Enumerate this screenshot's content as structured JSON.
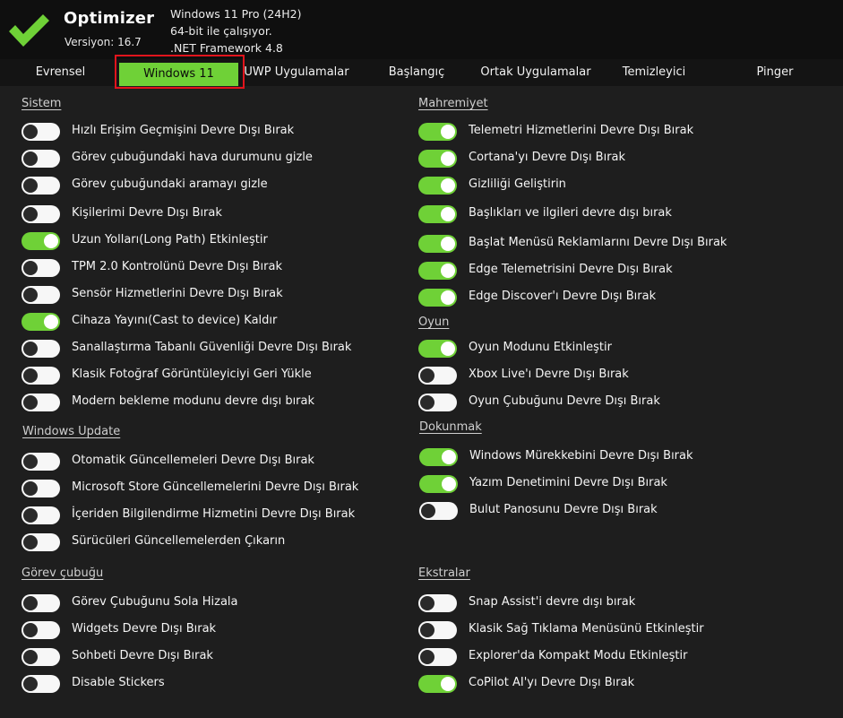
{
  "app": {
    "title": "Optimizer",
    "version": "Versiyon: 16.7",
    "logo_icon": "checkmark-icon",
    "accent_color": "#6fd137"
  },
  "system_info": {
    "os": "Windows 11 Pro (24H2)",
    "arch": "64-bit ile çalışıyor.",
    "framework": ".NET Framework 4.8"
  },
  "tabs": [
    {
      "label": "Evrensel"
    },
    {
      "label": "Windows 11",
      "active": true
    },
    {
      "label": "UWP Uygulamalar"
    },
    {
      "label": "Başlangıç"
    },
    {
      "label": "Ortak Uygulamalar"
    },
    {
      "label": "Temizleyici"
    },
    {
      "label": "Pinger"
    }
  ],
  "sections": {
    "sistem": {
      "title": "Sistem",
      "items": [
        {
          "label": "Hızlı Erişim Geçmişini Devre Dışı Bırak",
          "on": false
        },
        {
          "label": "Görev çubuğundaki hava durumunu gizle",
          "on": false
        },
        {
          "label": "Görev çubuğundaki aramayı gizle",
          "on": false
        },
        {
          "label": "Kişilerimi Devre Dışı Bırak",
          "on": false
        },
        {
          "label": "Uzun Yolları(Long Path) Etkinleştir",
          "on": true
        },
        {
          "label": "TPM 2.0 Kontrolünü Devre Dışı Bırak",
          "on": false
        },
        {
          "label": "Sensör Hizmetlerini Devre Dışı Bırak",
          "on": false
        },
        {
          "label": "Cihaza Yayını(Cast to device) Kaldır",
          "on": true
        },
        {
          "label": "Sanallaştırma Tabanlı Güvenliği Devre Dışı Bırak",
          "on": false
        },
        {
          "label": "Klasik Fotoğraf Görüntüleyiciyi Geri Yükle",
          "on": false
        },
        {
          "label": "Modern bekleme modunu devre dışı bırak",
          "on": false
        }
      ]
    },
    "windows_update": {
      "title": "Windows Update",
      "items": [
        {
          "label": "Otomatik Güncellemeleri Devre Dışı Bırak",
          "on": false
        },
        {
          "label": "Microsoft Store Güncellemelerini Devre Dışı Bırak",
          "on": false
        },
        {
          "label": "İçeriden Bilgilendirme Hizmetini Devre Dışı Bırak",
          "on": false
        },
        {
          "label": "Sürücüleri Güncellemelerden Çıkarın",
          "on": false
        }
      ]
    },
    "gorev_cubugu": {
      "title": "Görev çubuğu",
      "items": [
        {
          "label": "Görev Çubuğunu Sola Hizala",
          "on": false
        },
        {
          "label": "Widgets Devre Dışı Bırak",
          "on": false
        },
        {
          "label": "Sohbeti Devre Dışı Bırak",
          "on": false
        },
        {
          "label": "Disable Stickers",
          "on": false
        }
      ]
    },
    "mahremiyet": {
      "title": "Mahremiyet",
      "items": [
        {
          "label": "Telemetri Hizmetlerini Devre Dışı Bırak",
          "on": true
        },
        {
          "label": "Cortana'yı Devre Dışı Bırak",
          "on": true
        },
        {
          "label": "Gizliliği Geliştirin",
          "on": true
        },
        {
          "label": "Başlıkları ve ilgileri devre dışı bırak",
          "on": true
        },
        {
          "label": "Başlat Menüsü Reklamlarını Devre Dışı Bırak",
          "on": true
        },
        {
          "label": "Edge Telemetrisini Devre Dışı Bırak",
          "on": true
        },
        {
          "label": "Edge Discover'ı Devre Dışı Bırak",
          "on": true
        }
      ]
    },
    "oyun": {
      "title": "Oyun",
      "items": [
        {
          "label": "Oyun Modunu Etkinleştir",
          "on": true
        },
        {
          "label": "Xbox Live'ı Devre Dışı Bırak",
          "on": false
        },
        {
          "label": "Oyun Çubuğunu Devre Dışı Bırak",
          "on": false
        }
      ]
    },
    "dokunmak": {
      "title": "Dokunmak",
      "items": [
        {
          "label": "Windows Mürekkebini Devre Dışı Bırak",
          "on": true
        },
        {
          "label": "Yazım Denetimini Devre Dışı Bırak",
          "on": true
        },
        {
          "label": "Bulut Panosunu Devre Dışı Bırak",
          "on": false
        }
      ]
    },
    "ekstralar": {
      "title": "Ekstralar",
      "items": [
        {
          "label": "Snap Assist'i devre dışı bırak",
          "on": false
        },
        {
          "label": "Klasik Sağ Tıklama Menüsünü Etkinleştir",
          "on": false
        },
        {
          "label": "Explorer'da Kompakt Modu Etkinleştir",
          "on": false
        },
        {
          "label": "CoPilot AI'yı Devre Dışı Bırak",
          "on": true
        }
      ]
    }
  }
}
